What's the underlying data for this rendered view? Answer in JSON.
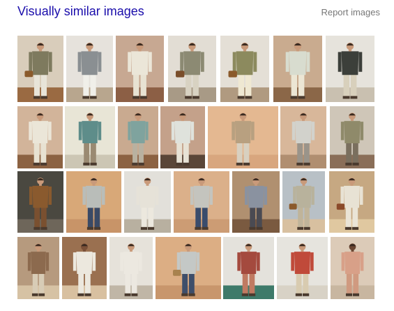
{
  "header": {
    "title": "Visually similar images",
    "report_label": "Report images"
  },
  "colors": {
    "link": "#1a0dab",
    "muted": "#777777"
  },
  "thumbnails": [
    {
      "bg": "#d9cdbb",
      "floor": "#9a6a42",
      "coat": "#7e7a5e",
      "pants": "#e8e4d8",
      "skin": "#c99a7a",
      "bag": "#8b5a2b"
    },
    {
      "bg": "#e6e2dc",
      "floor": "#b8a68e",
      "coat": "#8a8f92",
      "pants": "#f0efe9",
      "skin": "#c99a7a"
    },
    {
      "bg": "#c7a892",
      "floor": "#8c5f45",
      "coat": "#ebe6d8",
      "pants": "#e8e2d2",
      "skin": "#c99a7a"
    },
    {
      "bg": "#e2ddd4",
      "floor": "#a89a86",
      "coat": "#8c8a73",
      "pants": "#d8d2c2",
      "skin": "#c99a7a",
      "bag": "#7a4e2a"
    },
    {
      "bg": "#e4dfd6",
      "floor": "#b09a80",
      "coat": "#8c8a5e",
      "pants": "#efe8d2",
      "skin": "#c99a7a",
      "bag": "#8b5a2b"
    },
    {
      "bg": "#c9ab8f",
      "floor": "#8b6748",
      "coat": "#d8dccf",
      "pants": "#ece6d4",
      "skin": "#c99a7a"
    },
    {
      "bg": "#e6e3dc",
      "floor": "#c9c0b0",
      "coat": "#3c3f3a",
      "pants": "#d8d0bc",
      "skin": "#c99a7a"
    },
    {
      "bg": "#d2b49a",
      "floor": "#8c6242",
      "coat": "#ebe6d8",
      "pants": "#e8e2d2",
      "skin": "#c99a7a"
    },
    {
      "bg": "#e8e5d6",
      "floor": "#ccc6b4",
      "coat": "#5e8d8a",
      "pants": "#9a8a72",
      "skin": "#c99a7a"
    },
    {
      "bg": "#c9aa90",
      "floor": "#8c6242",
      "coat": "#7fa39e",
      "pants": "#b9b1a0",
      "skin": "#c99a7a"
    },
    {
      "bg": "#c4a18a",
      "floor": "#5a4638",
      "coat": "#dfe2dc",
      "pants": "#e7e2d5",
      "skin": "#c99a7a"
    },
    {
      "bg": "#e4b891",
      "floor": "#d8a67e",
      "coat": "#b8a080",
      "pants": "#d8d0c0",
      "skin": "#c99a7a"
    },
    {
      "bg": "#d8b79a",
      "floor": "#b08e70",
      "coat": "#d2d2cc",
      "pants": "#9a948a",
      "skin": "#c99a7a"
    },
    {
      "bg": "#cfc6b8",
      "floor": "#8a6e58",
      "coat": "#8f8a6a",
      "pants": "#7a6f5e",
      "skin": "#c99a7a"
    },
    {
      "bg": "#4a4840",
      "floor": "#6e665a",
      "coat": "#8a5a2e",
      "pants": "#7a5030",
      "skin": "#c99a7a"
    },
    {
      "bg": "#d8a878",
      "floor": "#c89468",
      "coat": "#b9bdb9",
      "pants": "#3a4a66",
      "skin": "#c99a7a"
    },
    {
      "bg": "#e2e0da",
      "floor": "#b8b0a0",
      "coat": "#e6e2d8",
      "pants": "#ece8de",
      "skin": "#c99a7a"
    },
    {
      "bg": "#dbb08a",
      "floor": "#cc9c74",
      "coat": "#c4c4be",
      "pants": "#3a4c6c",
      "skin": "#c99a7a"
    },
    {
      "bg": "#b09070",
      "floor": "#7a5a40",
      "coat": "#8a92a0",
      "pants": "#4a4a52",
      "skin": "#c99a7a"
    },
    {
      "bg": "#b8c0c6",
      "floor": "#d8c0a0",
      "coat": "#b8b29c",
      "pants": "#c0b49a",
      "skin": "#c99a7a",
      "bag": "#8b5a2b"
    },
    {
      "bg": "#c6a882",
      "floor": "#e0c8a0",
      "coat": "#e8e2d4",
      "pants": "#eae4d6",
      "skin": "#c99a7a",
      "bag": "#8b4a2a"
    },
    {
      "bg": "#b69a7e",
      "floor": "#d6c2a4",
      "coat": "#8c6a4e",
      "pants": "#d8ccb6",
      "skin": "#c99a7a"
    },
    {
      "bg": "#9a7050",
      "floor": "#d8c0a0",
      "coat": "#ece8de",
      "pants": "#ece8de",
      "skin": "#7a5038"
    },
    {
      "bg": "#e6e2da",
      "floor": "#c0b6a6",
      "coat": "#ece8e0",
      "pants": "#ece8e0",
      "skin": "#c99a7a"
    },
    {
      "bg": "#dcae84",
      "floor": "#c8966c",
      "coat": "#c4c8c6",
      "pants": "#3e4e6a",
      "skin": "#c99a7a",
      "bag": "#a8824e"
    },
    {
      "bg": "#e4e2dc",
      "floor": "#3e7a6a",
      "coat": "#a44a3e",
      "pants": "#c07a62",
      "skin": "#c99a7a"
    },
    {
      "bg": "#e6e4de",
      "floor": "#d8d2c6",
      "coat": "#c04a3a",
      "pants": "#d8cbb0",
      "skin": "#c99a7a"
    },
    {
      "bg": "#dccbb8",
      "floor": "#c8b6a0",
      "coat": "#d8a088",
      "pants": "#d09a80",
      "skin": "#6a4632"
    }
  ]
}
